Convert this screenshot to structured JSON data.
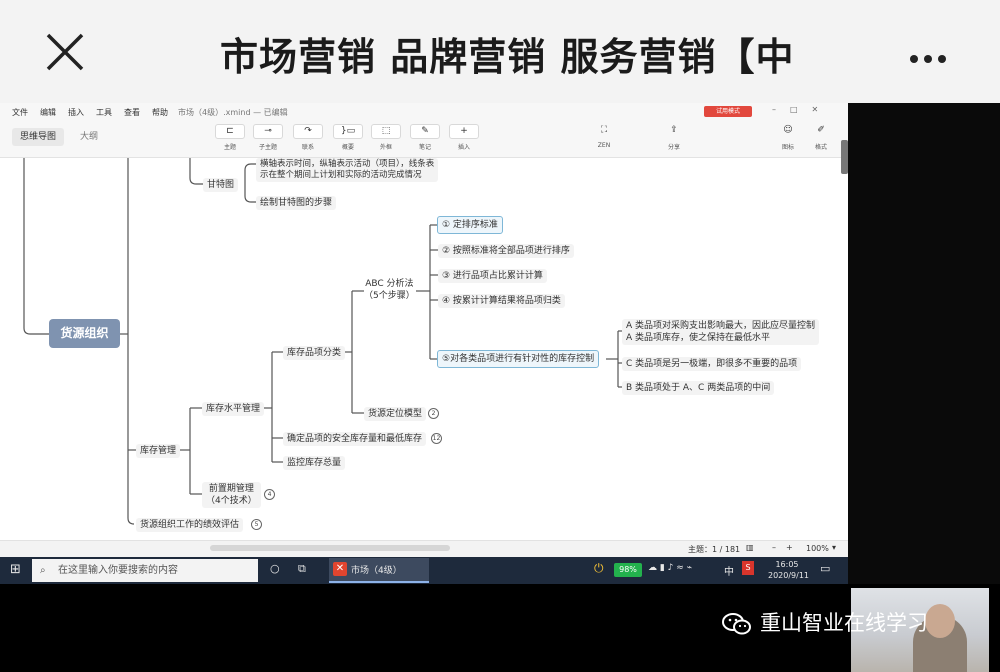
{
  "phone": {
    "title": "市场营销 品牌营销 服务营销【中",
    "close_icon": "close-icon",
    "more_icon": "more-dots-icon"
  },
  "app": {
    "menu": [
      "文件",
      "编辑",
      "插入",
      "工具",
      "查看",
      "帮助"
    ],
    "window_title": "市场（4级）.xmind — 已编辑",
    "trial_badge": "试用模式",
    "view_tabs": [
      "思维导图",
      "大纲"
    ],
    "tools": [
      {
        "icon": "topic-icon",
        "label": "主题"
      },
      {
        "icon": "subtopic-icon",
        "label": "子主题"
      },
      {
        "icon": "relationship-icon",
        "label": "联系"
      },
      {
        "icon": "summary-icon",
        "label": "概要"
      },
      {
        "icon": "boundary-icon",
        "label": "外框"
      },
      {
        "icon": "note-icon",
        "label": "笔记"
      },
      {
        "icon": "insert-icon",
        "label": "插入"
      }
    ],
    "zen": {
      "icon": "zen-icon",
      "label": "ZEN"
    },
    "share": {
      "icon": "share-icon",
      "label": "分享"
    },
    "right_tools": [
      {
        "icon": "emoji-icon",
        "label": "图标"
      },
      {
        "icon": "format-icon",
        "label": "格式"
      }
    ]
  },
  "mindmap": {
    "root": "货源组织",
    "gantt": {
      "label": "甘特图",
      "desc": "横轴表示时间，纵轴表示活动（项目），线条表示在整个期间上计划和实际的活动完成情况",
      "desc_line1": "横轴表示时间，纵轴表示活动（项目），线条表",
      "desc_line2": "示在整个期间上计划和实际的活动完成情况",
      "steps": "绘制甘特图的步骤"
    },
    "abc": {
      "label_line1": "ABC 分析法",
      "label_line2": "（5个步骤）",
      "steps": [
        "① 定排序标准",
        "② 按照标准将全部品项进行排序",
        "③ 进行品项占比累计计算",
        "④ 按累计计算结果将品项归类",
        "⑤对各类品项进行有针对性的库存控制"
      ],
      "controls": [
        "A 类品项对采购支出影响最大，因此应尽量控制",
        "A 类品项库存，使之保持在最低水平",
        "C 类品项是另一极端，即很多不重要的品项",
        "B 类品项处于 A、C 两类品项的中间"
      ]
    },
    "inventory_classification": "库存品项分类",
    "location_model": "货源定位模型",
    "location_model_count": "2",
    "level_management": "库存水平管理",
    "safety_stock": "确定品项的安全库存量和最低库存",
    "safety_stock_count": "12",
    "monitor_total": "监控库存总量",
    "inventory_management": "库存管理",
    "lead_time_line1": "前置期管理",
    "lead_time_line2": "（4个技术）",
    "lead_time_count": "4",
    "performance": "货源组织工作的绩效评估",
    "performance_count": "5"
  },
  "status": {
    "topic_count": "主题：1 / 181",
    "zoom": "100%",
    "zoom_minus": "–",
    "zoom_plus": "+"
  },
  "taskbar": {
    "search_placeholder": "在这里输入你要搜索的内容",
    "app_label": "市场（4级）",
    "battery": "98%",
    "ime": "中",
    "time": "16:05",
    "date": "2020/9/11"
  },
  "watermark": "重山智业在线学习",
  "colors": {
    "root_node": "#7f93b0",
    "selected_border": "#7eb7d7",
    "trial_badge": "#e2483d",
    "battery": "#23b24d",
    "taskbar": "#1e2a3c"
  }
}
